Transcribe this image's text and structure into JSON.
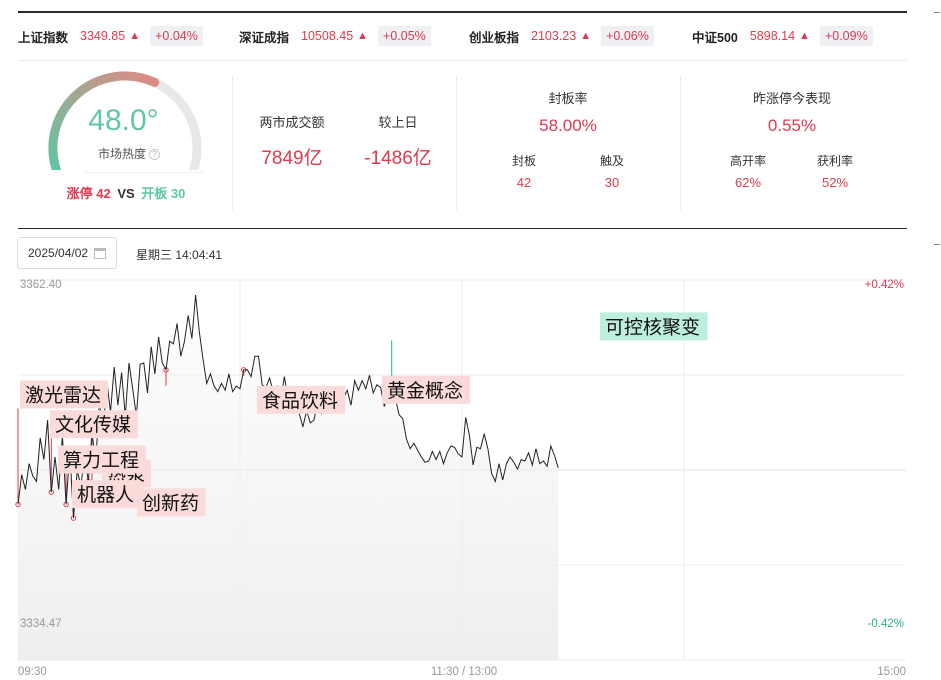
{
  "indices": [
    {
      "name": "上证指数",
      "price": "3349.85",
      "arrow": "▲",
      "change": "+0.04%"
    },
    {
      "name": "深证成指",
      "price": "10508.45",
      "arrow": "▲",
      "change": "+0.05%"
    },
    {
      "name": "创业板指",
      "price": "2103.23",
      "arrow": "▲",
      "change": "+0.06%"
    },
    {
      "name": "中证500",
      "price": "5898.14",
      "arrow": "▲",
      "change": "+0.09%"
    }
  ],
  "heat": {
    "value": "48.0°",
    "value_fraction": 0.48,
    "label": "市场热度",
    "help_icon": "question-circle-icon",
    "limit_up_label": "涨停",
    "limit_up_count": "42",
    "vs": "VS",
    "opened_label": "开板",
    "opened_count": "30",
    "colors": {
      "cool": "#5fc7a2",
      "warm": "#e08a84",
      "track": "#e8e8e8"
    }
  },
  "turnover": {
    "title": "两市成交额",
    "value": "7849亿",
    "compare_title": "较上日",
    "compare_value": "-1486亿"
  },
  "seal": {
    "title": "封板率",
    "value": "58.00%",
    "sub": [
      {
        "label": "封板",
        "value": "42"
      },
      {
        "label": "触及",
        "value": "30"
      }
    ]
  },
  "yesterday": {
    "title": "昨涨停今表现",
    "value": "0.55%",
    "sub": [
      {
        "label": "高开率",
        "value": "62%"
      },
      {
        "label": "获利率",
        "value": "52%"
      }
    ]
  },
  "date_picker": {
    "value": "2025/04/02",
    "icon": "calendar-icon"
  },
  "clock": {
    "text": "星期三 14:04:41"
  },
  "colors": {
    "up": "#e03a4e",
    "down": "#2db386",
    "tag_red_bg": "#fbdada",
    "tag_green_bg": "#bdeee0"
  },
  "chart_data": {
    "type": "line",
    "y_labels": {
      "top": "3362.40",
      "bottom": "3334.47"
    },
    "pct_labels": {
      "top": "+0.42%",
      "bottom": "-0.42%"
    },
    "x_labels": [
      "09:30",
      "11:30 / 13:00",
      "15:00"
    ],
    "ylim": [
      3334.47,
      3362.4
    ],
    "reference": 3348.44,
    "grid": true,
    "prices": [
      3345.9,
      3348.1,
      3347.0,
      3348.9,
      3348.0,
      3347.6,
      3350.8,
      3349.2,
      3352.1,
      3346.8,
      3349.4,
      3347.0,
      3351.0,
      3345.9,
      3349.8,
      3344.9,
      3348.4,
      3347.3,
      3349.5,
      3347.6,
      3351.2,
      3349.0,
      3353.5,
      3351.3,
      3355.0,
      3352.7,
      3356.0,
      3353.2,
      3355.6,
      3352.4,
      3356.3,
      3354.4,
      3352.4,
      3356.2,
      3356.3,
      3354.1,
      3357.5,
      3355.5,
      3358.2,
      3356.3,
      3355.8,
      3357.9,
      3357.7,
      3359.2,
      3356.8,
      3357.9,
      3359.8,
      3358.1,
      3361.3,
      3358.6,
      3356.6,
      3354.8,
      3355.5,
      3354.6,
      3354.2,
      3354.8,
      3354.3,
      3355.5,
      3354.2,
      3354.6,
      3354.4,
      3355.8,
      3355.8,
      3355.3,
      3356.8,
      3356.8,
      3354.7,
      3354.5,
      3355.2,
      3354.2,
      3354.6,
      3353.6,
      3355.3,
      3353.7,
      3354.1,
      3353.3,
      3352.6,
      3351.6,
      3352.8,
      3351.9,
      3352.1,
      3353.5,
      3352.6,
      3353.2,
      3353.7,
      3353.2,
      3353.7,
      3353.6,
      3353.8,
      3354.3,
      3353.2,
      3355.0,
      3354.3,
      3355.0,
      3354.4,
      3355.4,
      3354.1,
      3354.7,
      3354.5,
      3353.1,
      3354.1,
      3353.7,
      3353.7,
      3352.5,
      3352.2,
      3350.7,
      3350.0,
      3350.4,
      3349.9,
      3349.4,
      3349.0,
      3349.1,
      3349.8,
      3349.2,
      3349.8,
      3348.9,
      3349.7,
      3350.2,
      3350.1,
      3349.6,
      3349.4,
      3352.3,
      3351.0,
      3348.8,
      3350.1,
      3350.0,
      3351.1,
      3350.0,
      3348.2,
      3347.6,
      3348.9,
      3347.7,
      3348.9,
      3349.4,
      3349.0,
      3348.5,
      3349.2,
      3349.1,
      3349.7,
      3348.8,
      3350.0,
      3348.9,
      3349.1,
      3348.7,
      3350.2,
      3349.5,
      3348.6
    ],
    "annotations": [
      {
        "label": "热泵",
        "index": 19,
        "kind": "up"
      },
      {
        "label": "机器人",
        "index": 15,
        "kind": "up"
      },
      {
        "label": "算力工程",
        "index": 13,
        "kind": "up"
      },
      {
        "label": "文化传媒",
        "index": 9,
        "kind": "up"
      },
      {
        "label": "激光雷达",
        "index": 0,
        "kind": "up"
      },
      {
        "label": "创新药",
        "index": 20,
        "kind": "up"
      },
      {
        "label": "食品饮料",
        "index": 40,
        "kind": "up"
      },
      {
        "label": "黄金概念",
        "index": 61,
        "kind": "up"
      },
      {
        "label": "可控核聚变",
        "index": 101,
        "kind": "down"
      }
    ]
  }
}
